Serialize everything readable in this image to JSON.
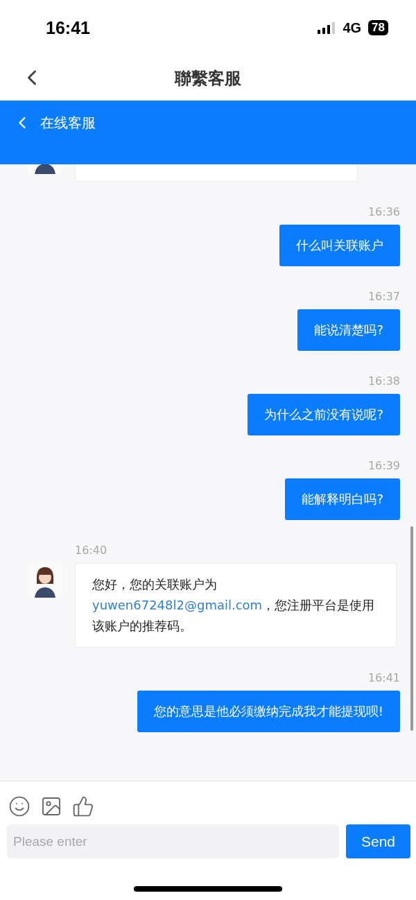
{
  "status_bar": {
    "time": "16:41",
    "network": "4G",
    "battery": "78"
  },
  "nav_bar": {
    "title": "聯繫客服"
  },
  "chat_header": {
    "title": "在线客服"
  },
  "messages": [
    {
      "kind": "cut-off"
    },
    {
      "kind": "outgoing",
      "time": "16:36",
      "text": "什么叫关联账户"
    },
    {
      "kind": "outgoing",
      "time": "16:37",
      "text": "能说清楚吗?"
    },
    {
      "kind": "outgoing",
      "time": "16:38",
      "text": "为什么之前没有说呢?"
    },
    {
      "kind": "outgoing",
      "time": "16:39",
      "text": "能解释明白吗?"
    },
    {
      "kind": "incoming",
      "time": "16:40",
      "parts": [
        {
          "kind": "text",
          "text": "您好，您的关联账户为 "
        },
        {
          "kind": "link",
          "text": "yuwen67248l2@gmail.com"
        },
        {
          "kind": "text",
          "text": "，您注册平台是使用该账户的推荐码。"
        }
      ]
    },
    {
      "kind": "outgoing",
      "time": "16:41",
      "text": "您的意思是他必须缴纳完成我才能提现呗!"
    }
  ],
  "composer": {
    "placeholder": "Please enter",
    "send": "Send"
  }
}
